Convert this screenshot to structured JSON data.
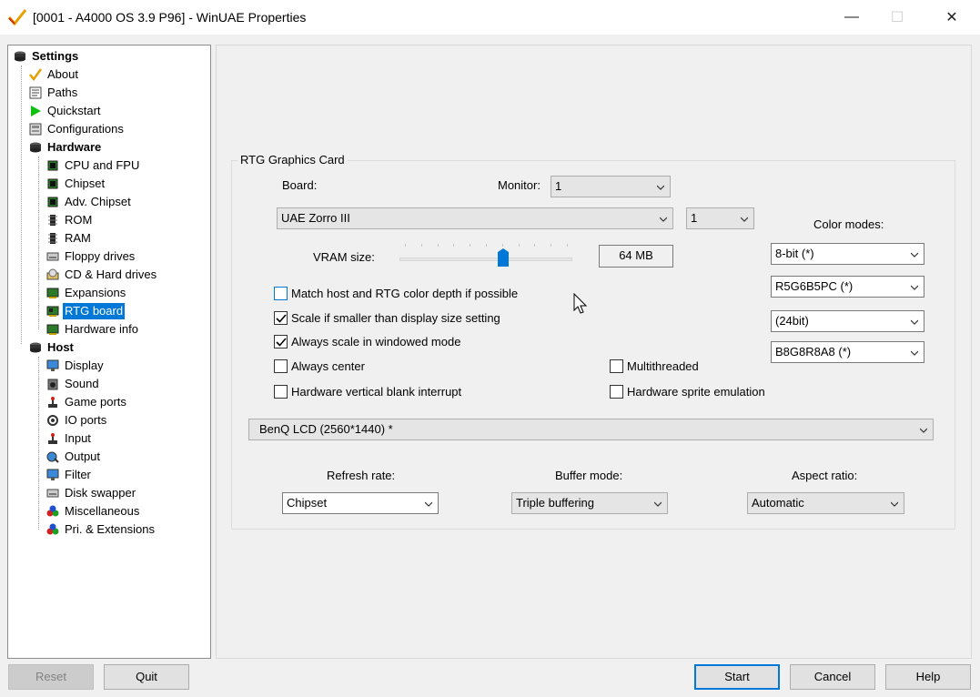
{
  "window": {
    "title": "[0001 - A4000 OS 3.9 P96] - WinUAE Properties",
    "min_symbol": "—",
    "max_symbol": "☐",
    "close_symbol": "✕"
  },
  "tree": {
    "settings": "Settings",
    "about": "About",
    "paths": "Paths",
    "quickstart": "Quickstart",
    "configurations": "Configurations",
    "hardware": "Hardware",
    "cpu": "CPU and FPU",
    "chipset": "Chipset",
    "adv_chipset": "Adv. Chipset",
    "rom": "ROM",
    "ram": "RAM",
    "floppy": "Floppy drives",
    "cd_hd": "CD & Hard drives",
    "expansions": "Expansions",
    "rtg": "RTG board",
    "hwinfo": "Hardware info",
    "host": "Host",
    "display": "Display",
    "sound": "Sound",
    "gameports": "Game ports",
    "ioports": "IO ports",
    "input": "Input",
    "output": "Output",
    "filter": "Filter",
    "diskswapper": "Disk swapper",
    "misc": "Miscellaneous",
    "pri_ext": "Pri. & Extensions"
  },
  "rtg": {
    "group_title": "RTG Graphics Card",
    "board_label": "Board:",
    "monitor_label": "Monitor:",
    "monitor_value": "1",
    "board_value": "UAE Zorro III",
    "board_index_value": "1",
    "color_modes_label": "Color modes:",
    "vram_label": "VRAM size:",
    "vram_value": "64 MB",
    "vram_slider_fraction": 0.6,
    "color_mode_1": "8-bit (*)",
    "color_mode_2": "R5G6B5PC (*)",
    "color_mode_3": "(24bit)",
    "color_mode_4": "B8G8R8A8 (*)",
    "match_host_label": "Match host and RTG color depth if possible",
    "scale_smaller_label": "Scale if smaller than display size setting",
    "always_scale_label": "Always scale in windowed mode",
    "always_center_label": "Always center",
    "multithreaded_label": "Multithreaded",
    "hw_vblank_label": "Hardware vertical blank interrupt",
    "hw_sprite_label": "Hardware sprite emulation",
    "display_value": "BenQ LCD (2560*1440) *",
    "refresh_label": "Refresh rate:",
    "refresh_value": "Chipset",
    "buffer_label": "Buffer mode:",
    "buffer_value": "Triple buffering",
    "aspect_label": "Aspect ratio:",
    "aspect_value": "Automatic"
  },
  "buttons": {
    "reset": "Reset",
    "quit": "Quit",
    "start": "Start",
    "cancel": "Cancel",
    "help": "Help"
  },
  "colors": {
    "selection": "#0078d7",
    "accent_thumb": "#0078d7"
  }
}
